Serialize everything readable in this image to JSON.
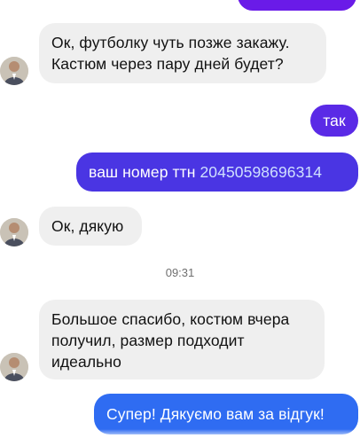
{
  "messages": [
    {
      "from": "them",
      "text": "Ок, футболку чуть позже закажу.\nКастюм через пару дней будет?"
    },
    {
      "from": "me",
      "text": "так"
    },
    {
      "from": "me",
      "text_prefix": "ваш номер ттн ",
      "ttn_number": "20450598696314"
    },
    {
      "from": "them",
      "text": "Ок, дякую"
    },
    {
      "from": "them",
      "text": "Большое спасибо, костюм вчера\nполучил, размер подходит\nидеально"
    },
    {
      "from": "me",
      "text": "Супер! Дякуємо вам за відгук!"
    }
  ],
  "timestamp": "09:31",
  "colors": {
    "outgoing_purple": "#6a1be8",
    "outgoing_indigo": "#4a35e3",
    "outgoing_blue": "#2f6cf2",
    "incoming_bg": "#efefef"
  },
  "icons": {
    "avatar": "user-avatar-photo"
  }
}
